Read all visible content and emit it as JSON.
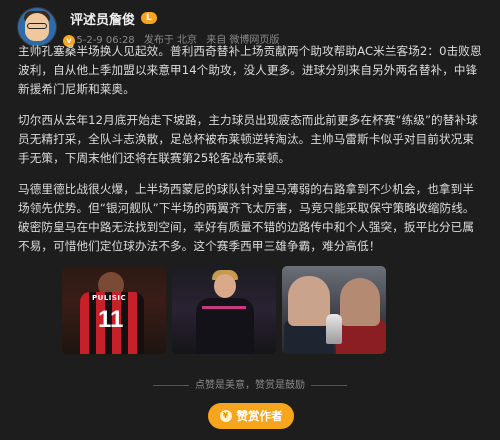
{
  "author": {
    "name": "评述员詹俊",
    "level_badge": "L",
    "verified_badge": "v",
    "timestamp": "25-2-9 06:28",
    "location": "发布于 北京",
    "source": "来自 微博网页版"
  },
  "body": {
    "paragraphs": [
      "主帅孔塞桑半场换人见起效。普利西奇替补上场贡献两个助攻帮助AC米兰客场2：0击败恩波利，自从他上季加盟以来意甲14个助攻，没人更多。进球分别来自另外两名替补，中锋新援希门尼斯和莱奥。",
      "切尔西从去年12月底开始走下坡路，主力球员出现疲态而此前更多在杯赛“练级”的替补球员无精打采，全队斗志涣散，足总杯被布莱顿逆转淘汰。主帅马雷斯卡似乎对目前状况束手无策，下周末他们还将在联赛第25轮客战布莱顿。",
      "马德里德比战很火爆，上半场西蒙尼的球队针对皇马薄弱的右路拿到不少机会，也拿到半场领先优势。但“银河舰队”下半场的两翼齐飞太厉害，马竞只能采取保守策略收缩防线。破密防皇马在中路无法找到空间，幸好有质量不错的边路传中和个人强突，扳平比分已属不易，可惜他们定位球办法不多。这个赛季西甲三雄争霸，难分高低！"
    ]
  },
  "images": [
    {
      "icon": "player-pulisic-photo",
      "jersey_name": "PULISIC",
      "jersey_number": "11"
    },
    {
      "icon": "chelsea-player-photo"
    },
    {
      "icon": "coaches-derby-photo"
    }
  ],
  "footer": {
    "hint": "点赞是美意，赞赏是鼓励",
    "reward_label": "赞赏作者",
    "reward_icon": "coin-icon"
  }
}
